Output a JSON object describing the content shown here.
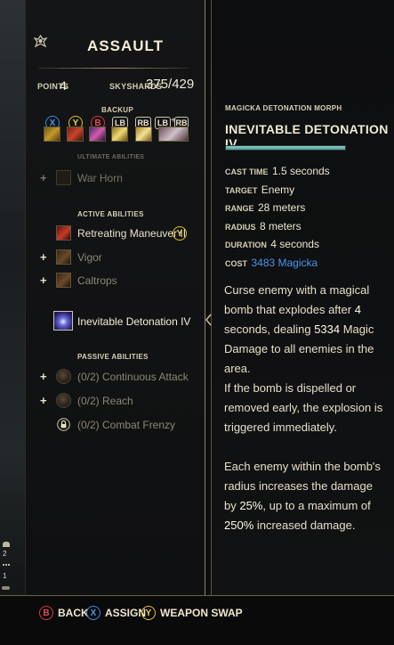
{
  "header": {
    "title": "ASSAULT",
    "points_label": "POINTS",
    "points_value": "4",
    "skyshards_label": "SKYSHARDS",
    "skyshards_value": "375/429"
  },
  "backup": {
    "label": "BACKUP",
    "buttons": [
      "X",
      "Y",
      "B",
      "LB",
      "RB",
      "LB",
      "+",
      "RB"
    ]
  },
  "sections": {
    "ultimate": "ULTIMATE ABILITIES",
    "active": "ACTIVE ABILITIES",
    "passive": "PASSIVE ABILITIES"
  },
  "ultimate_abilities": [
    {
      "name": "War Horn",
      "plus": "+",
      "dim": true
    }
  ],
  "active_abilities": [
    {
      "name": "Retreating Maneuver II",
      "button": "Y"
    },
    {
      "name": "Vigor",
      "plus": "+"
    },
    {
      "name": "Caltrops",
      "plus": "+"
    },
    {
      "name": "Inevitable Detonation IV",
      "selected": true
    }
  ],
  "passive_abilities": [
    {
      "name": "(0/2) Continuous Attack",
      "plus": "+"
    },
    {
      "name": "(0/2) Reach",
      "plus": "+"
    },
    {
      "name": "(0/2) Combat Frenzy",
      "locked": true
    }
  ],
  "detail": {
    "morph_label": "MAGICKA DETONATION MORPH",
    "title": "INEVITABLE DETONATION IV",
    "progress": 1.0,
    "props": [
      {
        "label": "CAST TIME",
        "value": "1.5 seconds"
      },
      {
        "label": "TARGET",
        "value": "Enemy"
      },
      {
        "label": "RANGE",
        "value": "28 meters"
      },
      {
        "label": "RADIUS",
        "value": "8 meters"
      },
      {
        "label": "DURATION",
        "value": "4 seconds"
      },
      {
        "label": "COST",
        "value": "3483 Magicka"
      }
    ],
    "desc1_a": "Curse enemy with a magical bomb that explodes after ",
    "desc1_b": "4",
    "desc1_c": " seconds, dealing ",
    "desc1_d": "5334",
    "desc1_e": " Magic Damage to all enemies in the area.",
    "desc2": "If the bomb is dispelled or removed early, the explosion is triggered immediately.",
    "desc3_a": "Each enemy within the bomb's radius increases the damage by ",
    "desc3_b": "25%",
    "desc3_c": ", up to a maximum of ",
    "desc3_d": "250%",
    "desc3_e": " increased damage."
  },
  "side_hud": {
    "values": [
      "2",
      "1"
    ]
  },
  "footer": {
    "back_button": "B",
    "back_label": "BACK",
    "assign_button": "X",
    "assign_label": "ASSIGN",
    "swap_button": "Y",
    "swap_label": "WEAPON SWAP"
  },
  "colors": {
    "accent_blue": "#4b95ea",
    "accent_gold": "#9a8c62",
    "progress_teal": "#6fb8b5"
  }
}
